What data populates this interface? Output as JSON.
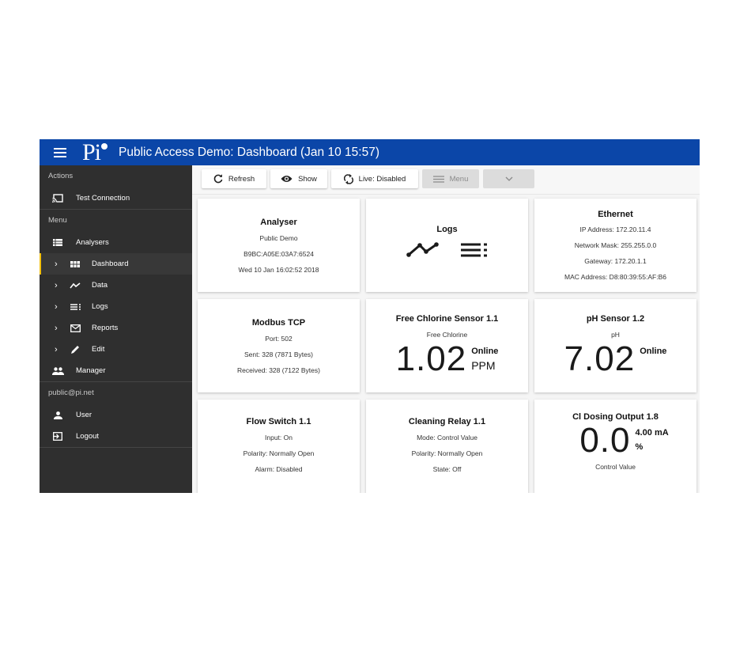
{
  "header": {
    "logo_text": "Pi",
    "title": "Public Access Demo: Dashboard (Jan 10 15:57)",
    "bar_color": "#0b46a8"
  },
  "sidebar": {
    "actions_heading": "Actions",
    "actions": [
      {
        "label": "Test Connection",
        "icon": "cast-icon"
      }
    ],
    "menu_heading": "Menu",
    "menu": [
      {
        "label": "Analysers",
        "icon": "list-icon"
      },
      {
        "label": "Dashboard",
        "icon": "grid-icon",
        "active": true
      },
      {
        "label": "Data",
        "icon": "chart-line-icon"
      },
      {
        "label": "Logs",
        "icon": "log-list-icon"
      },
      {
        "label": "Reports",
        "icon": "mail-icon"
      },
      {
        "label": "Edit",
        "icon": "pencil-icon"
      },
      {
        "label": "Manager",
        "icon": "people-icon"
      }
    ],
    "user_heading": "public@pi.net",
    "user_items": [
      {
        "label": "User",
        "icon": "person-icon"
      },
      {
        "label": "Logout",
        "icon": "logout-icon"
      }
    ],
    "active_color": "#f4c20d"
  },
  "toolbar": {
    "refresh": "Refresh",
    "show": "Show",
    "live": "Live: Disabled",
    "menu": "Menu"
  },
  "cards": {
    "analyser": {
      "title": "Analyser",
      "lines": [
        "Public Demo",
        "B9BC:A05E:03A7:6524",
        "Wed 10 Jan 16:02:52 2018"
      ]
    },
    "logs": {
      "title": "Logs"
    },
    "ethernet": {
      "title": "Ethernet",
      "lines": [
        "IP Address: 172.20.11.4",
        "Network Mask: 255.255.0.0",
        "Gateway: 172.20.1.1",
        "MAC Address: D8:80:39:55:AF:B6"
      ]
    },
    "modbus": {
      "title": "Modbus TCP",
      "lines": [
        "Port: 502",
        "Sent: 328 (7871 Bytes)",
        "Received: 328 (7122 Bytes)"
      ]
    },
    "chlorine": {
      "title": "Free Chlorine Sensor 1.1",
      "subtitle": "Free Chlorine",
      "value": "1.02",
      "status": "Online",
      "unit": "PPM"
    },
    "ph": {
      "title": "pH Sensor 1.2",
      "subtitle": "pH",
      "value": "7.02",
      "status": "Online"
    },
    "flow": {
      "title": "Flow Switch 1.1",
      "lines": [
        "Input: On",
        "Polarity: Normally Open",
        "Alarm: Disabled"
      ]
    },
    "relay": {
      "title": "Cleaning Relay 1.1",
      "lines": [
        "Mode: Control Value",
        "Polarity: Normally Open",
        "State: Off"
      ]
    },
    "dosing": {
      "title": "Cl Dosing Output 1.8",
      "value": "0.0",
      "current": "4.00 mA",
      "unit": "%",
      "caption": "Control Value"
    }
  }
}
